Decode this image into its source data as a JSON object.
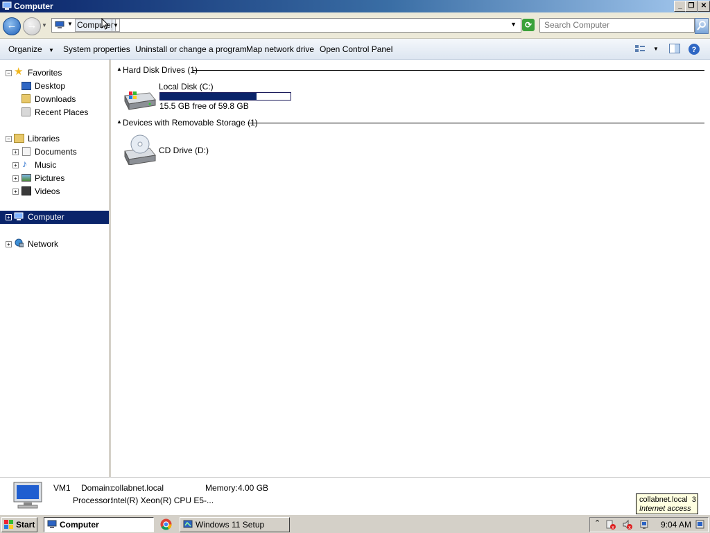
{
  "window": {
    "title": "Computer"
  },
  "caption_buttons": {
    "minimize": "_",
    "restore": "❐",
    "close": "✕"
  },
  "address_bar": {
    "breadcrumb": "Computer",
    "search_placeholder": "Search Computer"
  },
  "command_bar": {
    "organize": "Organize",
    "system_properties": "System properties",
    "uninstall": "Uninstall or change a program",
    "map_drive": "Map network drive",
    "control_panel": "Open Control Panel"
  },
  "nav": {
    "favorites": "Favorites",
    "desktop": "Desktop",
    "downloads": "Downloads",
    "recent": "Recent Places",
    "libraries": "Libraries",
    "documents": "Documents",
    "music": "Music",
    "pictures": "Pictures",
    "videos": "Videos",
    "computer": "Computer",
    "network": "Network"
  },
  "content": {
    "hdd_group": "Hard Disk Drives (1)",
    "local_disk": "Local Disk (C:)",
    "local_disk_free": "15.5 GB free of 59.8 GB",
    "local_disk_used_fraction": 0.741,
    "removable_group": "Devices with Removable Storage (1)",
    "cd_drive": "CD Drive (D:)"
  },
  "details": {
    "name": "VM1",
    "domain_label": "Domain:",
    "domain_value": "collabnet.local",
    "memory_label": "Memory:",
    "memory_value": "4.00 GB",
    "processor_label": "Processor:",
    "processor_value": "Intel(R) Xeon(R) CPU E5-..."
  },
  "taskbar": {
    "start": "Start",
    "computer": "Computer",
    "setup": "Windows 11 Setup",
    "clock": "9:04 AM"
  },
  "tooltip": {
    "line1": "collabnet.local  3",
    "line2": "Internet access"
  },
  "colors": {
    "selection": "#0a246a",
    "capacity_fill": "#0a246a"
  }
}
